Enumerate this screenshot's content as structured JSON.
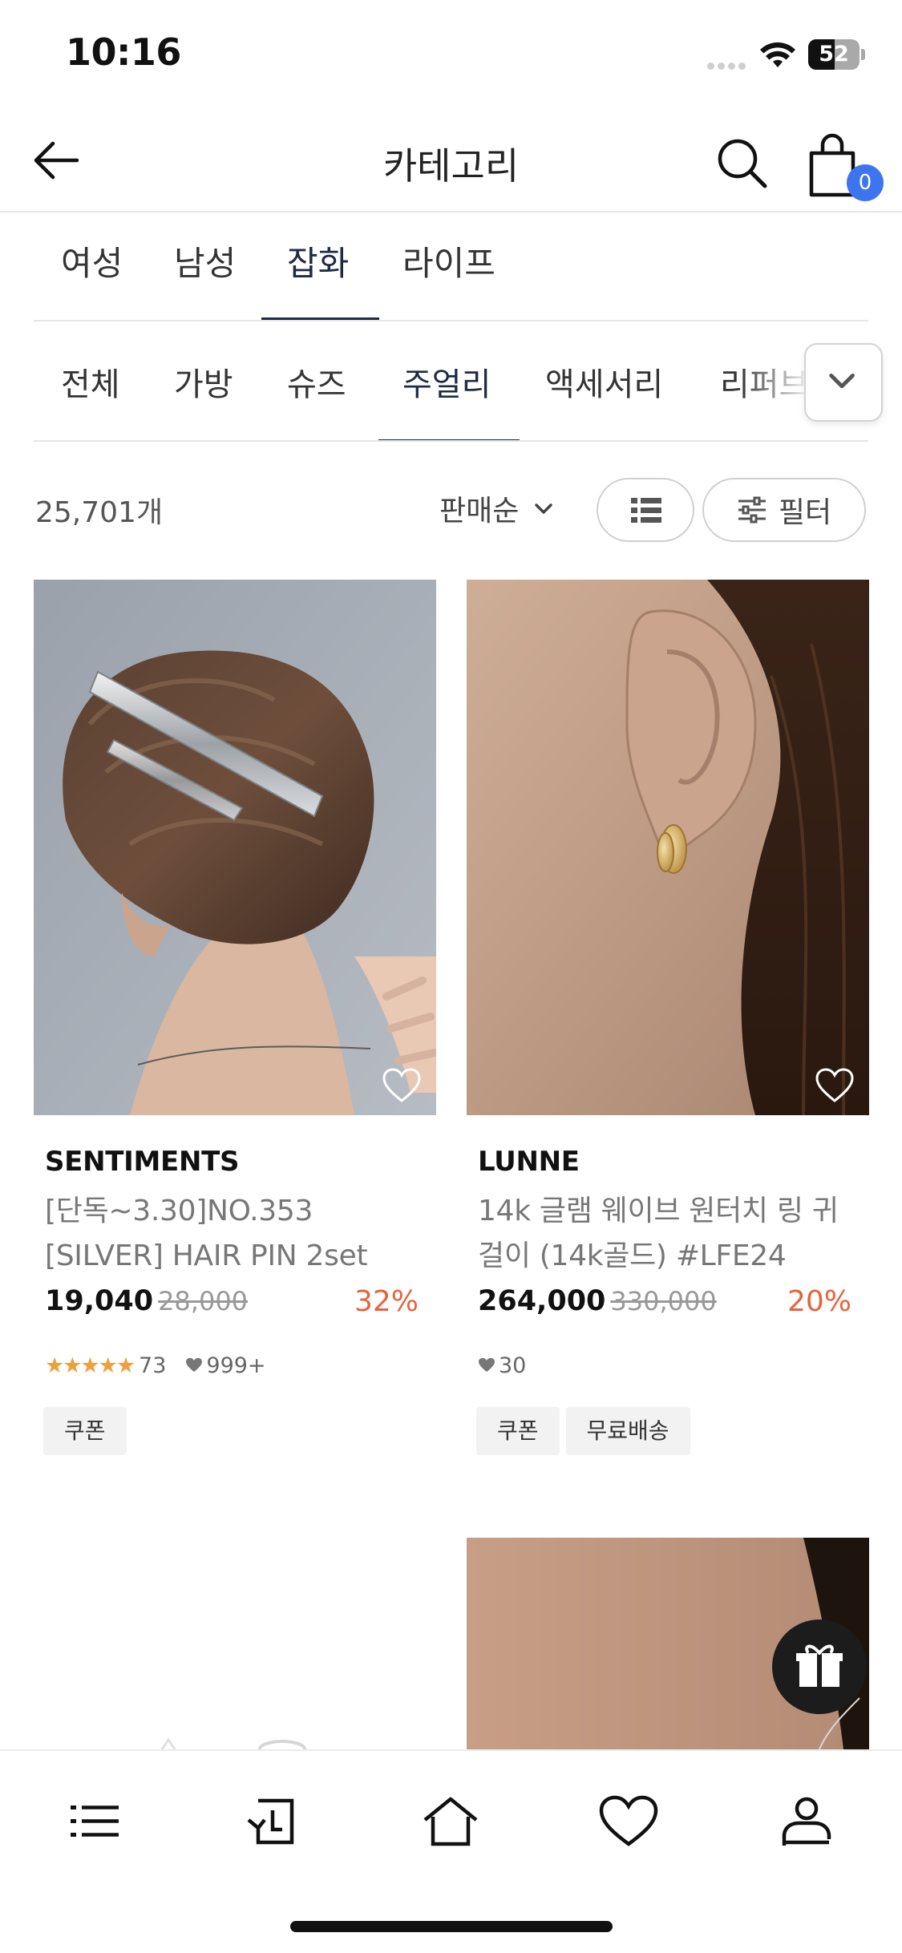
{
  "status_bar": {
    "time": "10:16",
    "battery": "52",
    "battery_percent": 52
  },
  "header": {
    "title": "카테고리",
    "cart_count": "0"
  },
  "primary_tabs": [
    {
      "label": "여성",
      "active": false
    },
    {
      "label": "남성",
      "active": false
    },
    {
      "label": "잡화",
      "active": true
    },
    {
      "label": "라이프",
      "active": false
    }
  ],
  "secondary_tabs": [
    {
      "label": "전체",
      "active": false
    },
    {
      "label": "가방",
      "active": false
    },
    {
      "label": "슈즈",
      "active": false
    },
    {
      "label": "주얼리",
      "active": true
    },
    {
      "label": "액세서리",
      "active": false
    },
    {
      "label": "리퍼브",
      "active": false
    }
  ],
  "toolbar": {
    "count": "25,701개",
    "sort": "판매순",
    "filter": "필터"
  },
  "products": [
    {
      "brand": "SENTIMENTS",
      "name": "[단독~3.30]NO.353 [SILVER] HAIR PIN 2set X…",
      "price": "19,040",
      "original_price": "28,000",
      "discount": "32%",
      "rating_stars": "★★★★★",
      "review_count": "73",
      "likes": "999+",
      "tags": [
        "쿠폰"
      ]
    },
    {
      "brand": "LUNNE",
      "name": "14k 글램 웨이브 원터치 링 귀걸이 (14k골드) #LFE24",
      "price": "264,000",
      "original_price": "330,000",
      "discount": "20%",
      "likes": "30",
      "tags": [
        "쿠폰",
        "무료배송"
      ]
    }
  ],
  "colors": {
    "accent": "#1f2a44",
    "discount": "#e4643c",
    "badge": "#3d74f0",
    "star": "#efa03d"
  },
  "icons": {
    "header": [
      "back-arrow-icon",
      "search-icon",
      "shopping-bag-icon"
    ],
    "bottom_nav": [
      "menu-icon",
      "recent-icon",
      "home-icon",
      "heart-icon",
      "profile-icon"
    ],
    "floating": "gift-icon"
  }
}
